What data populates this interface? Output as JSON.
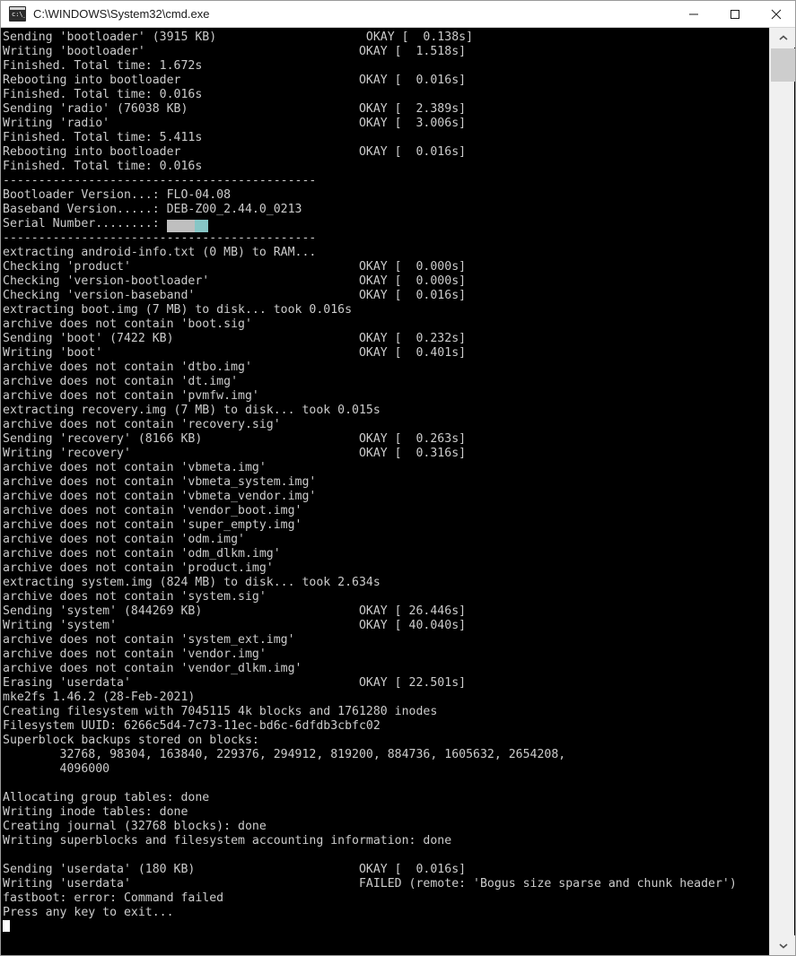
{
  "window": {
    "title": "C:\\WINDOWS\\System32\\cmd.exe",
    "icon": "cmd-icon",
    "icon_glyph": "c:\\_",
    "controls": {
      "minimize": "minimize-button",
      "maximize": "maximize-button",
      "close": "close-button"
    },
    "background_color": "#000000",
    "text_color": "#cccccc",
    "titlebar_color": "#ffffff"
  },
  "scrollbar": {
    "up_arrow": "scroll-up-arrow",
    "down_arrow": "scroll-down-arrow",
    "thumb": "scroll-thumb"
  },
  "console": {
    "cursor_visible": true,
    "redaction": {
      "gray_color": "#bfbfbf",
      "teal_color": "#87c6c6"
    },
    "lines": [
      "Sending 'bootloader' (3915 KB)                     OKAY [  0.138s]",
      "Writing 'bootloader'                              OKAY [  1.518s]",
      "Finished. Total time: 1.672s",
      "Rebooting into bootloader                         OKAY [  0.016s]",
      "Finished. Total time: 0.016s",
      "Sending 'radio' (76038 KB)                        OKAY [  2.389s]",
      "Writing 'radio'                                   OKAY [  3.006s]",
      "Finished. Total time: 5.411s",
      "Rebooting into bootloader                         OKAY [  0.016s]",
      "Finished. Total time: 0.016s",
      "--------------------------------------------",
      "Bootloader Version...: FLO-04.08",
      "Baseband Version.....: DEB-Z00_2.44.0_0213",
      "__SERIAL_REDACTED__",
      "--------------------------------------------",
      "extracting android-info.txt (0 MB) to RAM...",
      "Checking 'product'                                OKAY [  0.000s]",
      "Checking 'version-bootloader'                     OKAY [  0.000s]",
      "Checking 'version-baseband'                       OKAY [  0.016s]",
      "extracting boot.img (7 MB) to disk... took 0.016s",
      "archive does not contain 'boot.sig'",
      "Sending 'boot' (7422 KB)                          OKAY [  0.232s]",
      "Writing 'boot'                                    OKAY [  0.401s]",
      "archive does not contain 'dtbo.img'",
      "archive does not contain 'dt.img'",
      "archive does not contain 'pvmfw.img'",
      "extracting recovery.img (7 MB) to disk... took 0.015s",
      "archive does not contain 'recovery.sig'",
      "Sending 'recovery' (8166 KB)                      OKAY [  0.263s]",
      "Writing 'recovery'                                OKAY [  0.316s]",
      "archive does not contain 'vbmeta.img'",
      "archive does not contain 'vbmeta_system.img'",
      "archive does not contain 'vbmeta_vendor.img'",
      "archive does not contain 'vendor_boot.img'",
      "archive does not contain 'super_empty.img'",
      "archive does not contain 'odm.img'",
      "archive does not contain 'odm_dlkm.img'",
      "archive does not contain 'product.img'",
      "extracting system.img (824 MB) to disk... took 2.634s",
      "archive does not contain 'system.sig'",
      "Sending 'system' (844269 KB)                      OKAY [ 26.446s]",
      "Writing 'system'                                  OKAY [ 40.040s]",
      "archive does not contain 'system_ext.img'",
      "archive does not contain 'vendor.img'",
      "archive does not contain 'vendor_dlkm.img'",
      "Erasing 'userdata'                                OKAY [ 22.501s]",
      "mke2fs 1.46.2 (28-Feb-2021)",
      "Creating filesystem with 7045115 4k blocks and 1761280 inodes",
      "Filesystem UUID: 6266c5d4-7c73-11ec-bd6c-6dfdb3cbfc02",
      "Superblock backups stored on blocks:",
      "        32768, 98304, 163840, 229376, 294912, 819200, 884736, 1605632, 2654208,",
      "        4096000",
      "",
      "Allocating group tables: done",
      "Writing inode tables: done",
      "Creating journal (32768 blocks): done",
      "Writing superblocks and filesystem accounting information: done",
      "",
      "Sending 'userdata' (180 KB)                       OKAY [  0.016s]",
      "Writing 'userdata'                                FAILED (remote: 'Bogus size sparse and chunk header')",
      "fastboot: error: Command failed",
      "Press any key to exit...",
      "__CURSOR__"
    ],
    "serial_line_label": "Serial Number........: "
  }
}
